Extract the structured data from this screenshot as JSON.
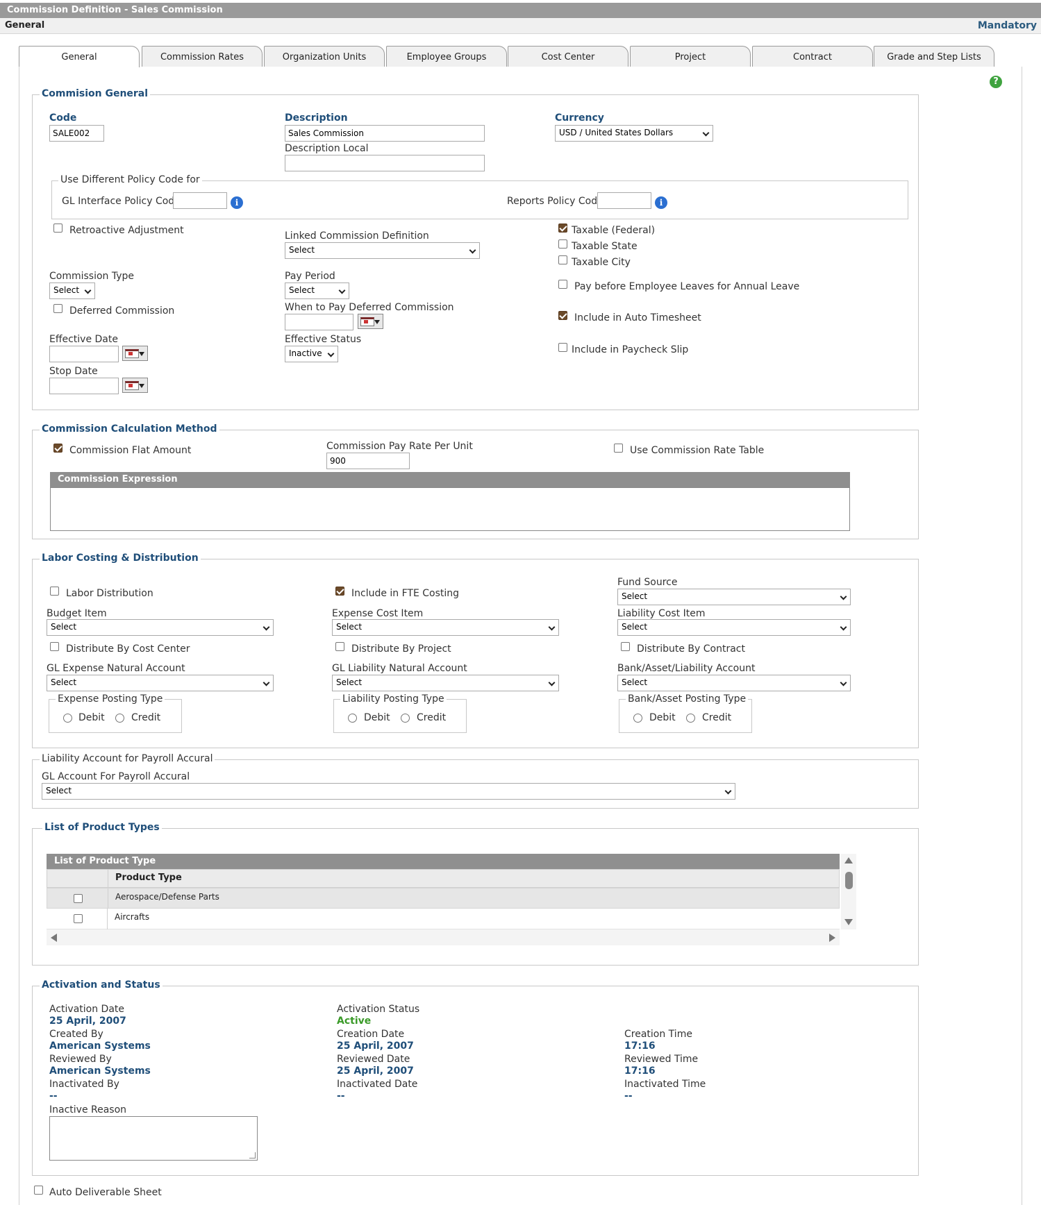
{
  "window": {
    "title": "Commission Definition - Sales Commission"
  },
  "subheader": {
    "title": "General",
    "mandatory": "Mandatory"
  },
  "tabs": [
    "General",
    "Commission Rates",
    "Organization Units",
    "Employee Groups",
    "Cost Center",
    "Project",
    "Contract",
    "Grade and Step Lists"
  ],
  "general": {
    "legend": "Commision General",
    "code_label": "Code",
    "code_value": "SALE002",
    "description_label": "Description",
    "description_value": "Sales Commission",
    "description_local_label": "Description Local",
    "currency_label": "Currency",
    "currency_value": "USD / United States Dollars",
    "policy_legend": "Use Different Policy Code for",
    "gl_interface_label": "GL Interface Policy Code",
    "reports_policy_label": "Reports Policy Code",
    "retroactive_label": "Retroactive Adjustment",
    "linked_label": "Linked Commission Definition",
    "linked_value": "Select",
    "taxable_federal": "Taxable (Federal)",
    "taxable_state": "Taxable State",
    "taxable_city": "Taxable City",
    "commission_type_label": "Commission Type",
    "commission_type_value": "Select",
    "pay_period_label": "Pay Period",
    "pay_period_value": "Select",
    "pay_before_label": "Pay before Employee Leaves for Annual Leave",
    "deferred_label": "Deferred Commission",
    "when_to_pay_label": "When to Pay Deferred Commission",
    "auto_timesheet_label": "Include in Auto Timesheet",
    "effective_date_label": "Effective Date",
    "effective_status_label": "Effective Status",
    "effective_status_value": "Inactive",
    "paycheck_label": "Include in Paycheck Slip",
    "stop_date_label": "Stop Date"
  },
  "calc": {
    "legend": "Commission Calculation Method",
    "flat_amount_label": "Commission Flat Amount",
    "pay_rate_label": "Commission Pay Rate Per Unit",
    "pay_rate_value": "900",
    "rate_table_label": "Use Commission Rate Table",
    "expression_header": "Commission Expression"
  },
  "labor": {
    "legend": "Labor Costing & Distribution",
    "labor_distribution_label": "Labor Distribution",
    "fte_label": "Include in FTE Costing",
    "fund_source_label": "Fund Source",
    "fund_source_value": "Select",
    "budget_item_label": "Budget Item",
    "budget_item_value": "Select",
    "expense_cost_label": "Expense Cost Item",
    "expense_cost_value": "Select",
    "liability_cost_label": "Liability Cost Item",
    "liability_cost_value": "Select",
    "dist_cost_center": "Distribute By Cost Center",
    "dist_project": "Distribute By Project",
    "dist_contract": "Distribute By Contract",
    "gl_expense_label": "GL Expense Natural Account",
    "gl_expense_value": "Select",
    "gl_liability_label": "GL Liability Natural Account",
    "gl_liability_value": "Select",
    "bank_label": "Bank/Asset/Liability Account",
    "bank_value": "Select",
    "expense_posting_legend": "Expense Posting Type",
    "liability_posting_legend": "Liability Posting Type",
    "bank_posting_legend": "Bank/Asset Posting Type",
    "debit": "Debit",
    "credit": "Credit"
  },
  "accrual": {
    "legend": "Liability Account for Payroll Accural",
    "gl_account_label": "GL Account For Payroll Accural",
    "gl_account_value": "Select"
  },
  "products": {
    "legend": "List of Product Types",
    "table_title": "List of Product Type",
    "column_header": "Product Type",
    "rows": [
      "Aerospace/Defense Parts",
      "Aircrafts"
    ]
  },
  "activation": {
    "legend": "Activation and Status",
    "activation_date_label": "Activation Date",
    "activation_date_value": "25 April, 2007",
    "activation_status_label": "Activation Status",
    "activation_status_value": "Active",
    "created_by_label": "Created By",
    "created_by_value": "American Systems",
    "creation_date_label": "Creation Date",
    "creation_date_value": "25 April, 2007",
    "creation_time_label": "Creation Time",
    "creation_time_value": "17:16",
    "reviewed_by_label": "Reviewed By",
    "reviewed_by_value": "American Systems",
    "reviewed_date_label": "Reviewed Date",
    "reviewed_date_value": "25 April, 2007",
    "reviewed_time_label": "Reviewed Time",
    "reviewed_time_value": "17:16",
    "inactivated_by_label": "Inactivated By",
    "inactivated_by_value": "--",
    "inactivated_date_label": "Inactivated Date",
    "inactivated_date_value": "--",
    "inactivated_time_label": "Inactivated Time",
    "inactivated_time_value": "--",
    "inactive_reason_label": "Inactive Reason"
  },
  "footer": {
    "auto_deliverable_label": "Auto Deliverable Sheet"
  }
}
